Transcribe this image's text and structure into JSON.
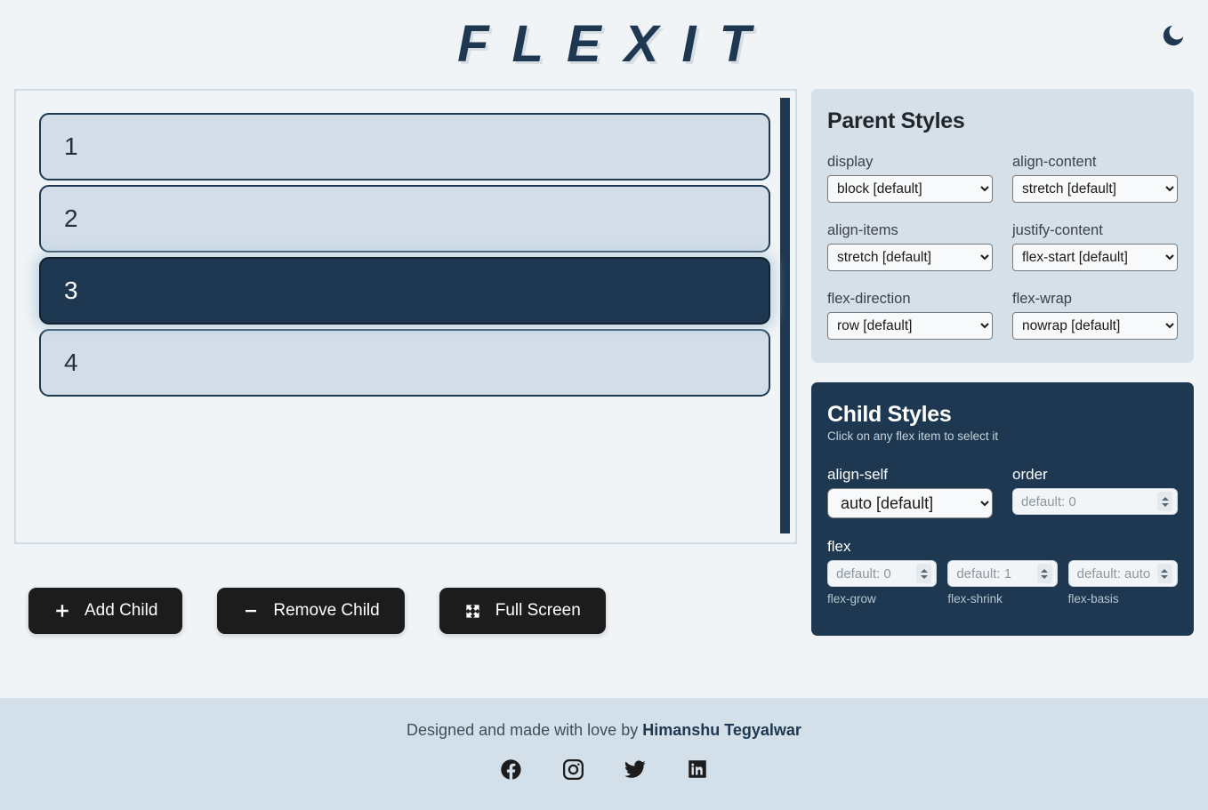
{
  "header": {
    "brand": "FLEXIT",
    "theme_toggle_icon": "moon-icon"
  },
  "preview": {
    "items": [
      {
        "label": "1",
        "selected": false
      },
      {
        "label": "2",
        "selected": false
      },
      {
        "label": "3",
        "selected": true
      },
      {
        "label": "4",
        "selected": false
      }
    ]
  },
  "actions": {
    "add_child": "Add Child",
    "add_child_icon": "plus-icon",
    "remove_child": "Remove Child",
    "remove_child_icon": "minus-icon",
    "full_screen": "Full Screen",
    "full_screen_icon": "expand-arrows-icon"
  },
  "parent_styles": {
    "title": "Parent Styles",
    "fields": [
      {
        "label": "display",
        "value": "block [default]"
      },
      {
        "label": "align-content",
        "value": "stretch [default]"
      },
      {
        "label": "align-items",
        "value": "stretch [default]"
      },
      {
        "label": "justify-content",
        "value": "flex-start [default]"
      },
      {
        "label": "flex-direction",
        "value": "row [default]"
      },
      {
        "label": "flex-wrap",
        "value": "nowrap [default]"
      }
    ]
  },
  "child_styles": {
    "title": "Child Styles",
    "subtitle": "Click on any flex item to select it",
    "align_self": {
      "label": "align-self",
      "value": "auto [default]"
    },
    "order": {
      "label": "order",
      "placeholder": "default: 0",
      "value": ""
    },
    "flex": {
      "label": "flex",
      "inputs": [
        {
          "placeholder": "default: 0",
          "value": "",
          "sub_label": "flex-grow"
        },
        {
          "placeholder": "default: 1",
          "value": "",
          "sub_label": "flex-shrink"
        },
        {
          "placeholder": "default: auto",
          "value": "",
          "sub_label": "flex-basis"
        }
      ]
    }
  },
  "footer": {
    "credit_prefix": "Designed and made with love by ",
    "author": "Himanshu Tegyalwar",
    "socials": [
      {
        "name": "facebook-icon"
      },
      {
        "name": "instagram-icon"
      },
      {
        "name": "twitter-icon"
      },
      {
        "name": "linkedin-icon"
      }
    ]
  },
  "colors": {
    "page_bg": "#f0f4f7",
    "navy": "#1d3850",
    "panel_light": "#d6e0e9",
    "footer_bg": "#d4e0e9",
    "button_dark": "#1c1c1c",
    "item_bg": "#d2dde7"
  }
}
